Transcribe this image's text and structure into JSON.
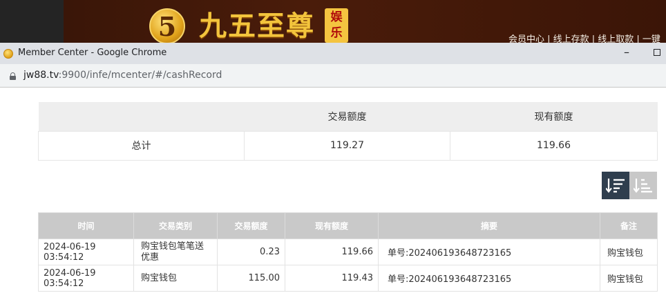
{
  "background_site": {
    "logo_numeral": "5",
    "logo_text": "九五至尊",
    "logo_tag": "娱乐",
    "nav_text": "会员中心 | 线上存款 | 线上取款 | 一键"
  },
  "window": {
    "title": "Member Center - Google Chrome",
    "minimize_glyph": "–"
  },
  "address_bar": {
    "host": "jw88.tv",
    "rest": ":9900/infe/mcenter/#/cashRecord"
  },
  "summary": {
    "headers": [
      "",
      "交易额度",
      "现有额度"
    ],
    "row": {
      "label": "总计",
      "transaction_amount": "119.27",
      "current_amount": "119.66"
    }
  },
  "sort_controls": {
    "desc_icon": "sort-descending-icon",
    "asc_icon": "sort-ascending-icon"
  },
  "records": {
    "headers": [
      "时间",
      "交易类别",
      "交易额度",
      "现有额度",
      "摘要",
      "备注"
    ],
    "rows": [
      {
        "time": "2024-06-19 03:54:12",
        "type": "购宝钱包笔笔送优惠",
        "amount": "0.23",
        "balance": "119.66",
        "summary": "单号:202406193648723165",
        "note": "购宝钱包"
      },
      {
        "time": "2024-06-19 03:54:12",
        "type": "购宝钱包",
        "amount": "115.00",
        "balance": "119.43",
        "summary": "单号:202406193648723165",
        "note": "购宝钱包"
      }
    ]
  },
  "colors": {
    "banner": "#4a1c0a",
    "logo_gold": "#f3c43c",
    "titlebar": "#dee1e6",
    "sort_active": "#2f3e4e",
    "sort_inactive": "#c8c8c8",
    "table_header": "#c9c9c9"
  }
}
